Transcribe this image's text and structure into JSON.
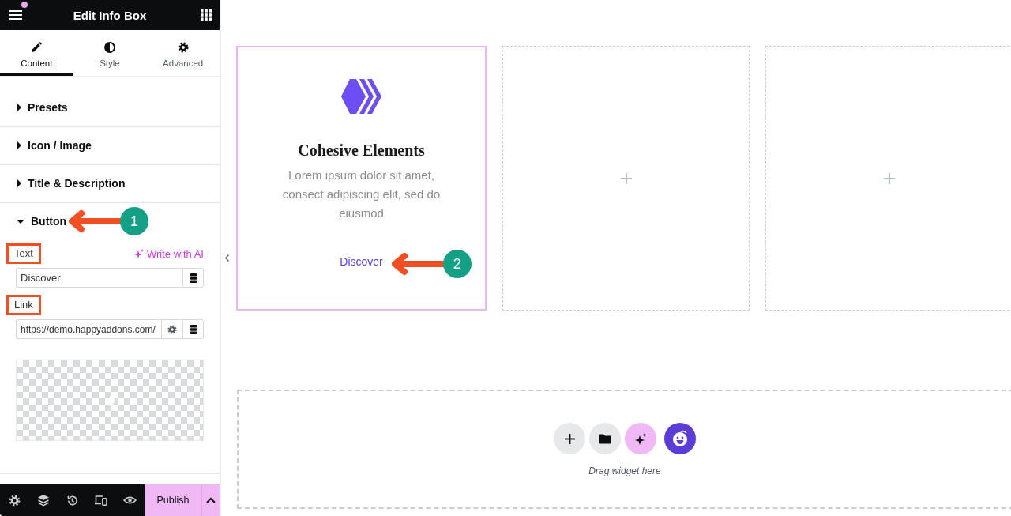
{
  "sidebar": {
    "header": {
      "title": "Edit Info Box",
      "notification": true
    },
    "tabs": [
      {
        "label": "Content",
        "selected": true
      },
      {
        "label": "Style",
        "selected": false
      },
      {
        "label": "Advanced",
        "selected": false
      }
    ],
    "sections": [
      {
        "label": "Presets",
        "expanded": false
      },
      {
        "label": "Icon / Image",
        "expanded": false
      },
      {
        "label": "Title & Description",
        "expanded": false
      },
      {
        "label": "Button",
        "expanded": true,
        "annotation": "1",
        "fields": [
          {
            "kind": "text",
            "label": "Text",
            "highlighted": true,
            "value": "Discover",
            "ai_action": "Write with AI"
          },
          {
            "kind": "link",
            "label": "Link",
            "highlighted": true,
            "value": "https://demo.happyaddons.com/"
          }
        ]
      }
    ],
    "footer": {
      "publish": "Publish"
    }
  },
  "canvas": {
    "cards": [
      {
        "kind": "info_box",
        "selected": true,
        "title": "Cohesive Elements",
        "description": "Lorem ipsum dolor sit amet, consect adipiscing elit, sed do eiusmod",
        "link": "Discover",
        "annotation": "2"
      },
      {
        "kind": "empty",
        "selected": false
      },
      {
        "kind": "empty",
        "selected": false
      }
    ],
    "drop_zone": {
      "hint": "Drag widget here"
    }
  }
}
